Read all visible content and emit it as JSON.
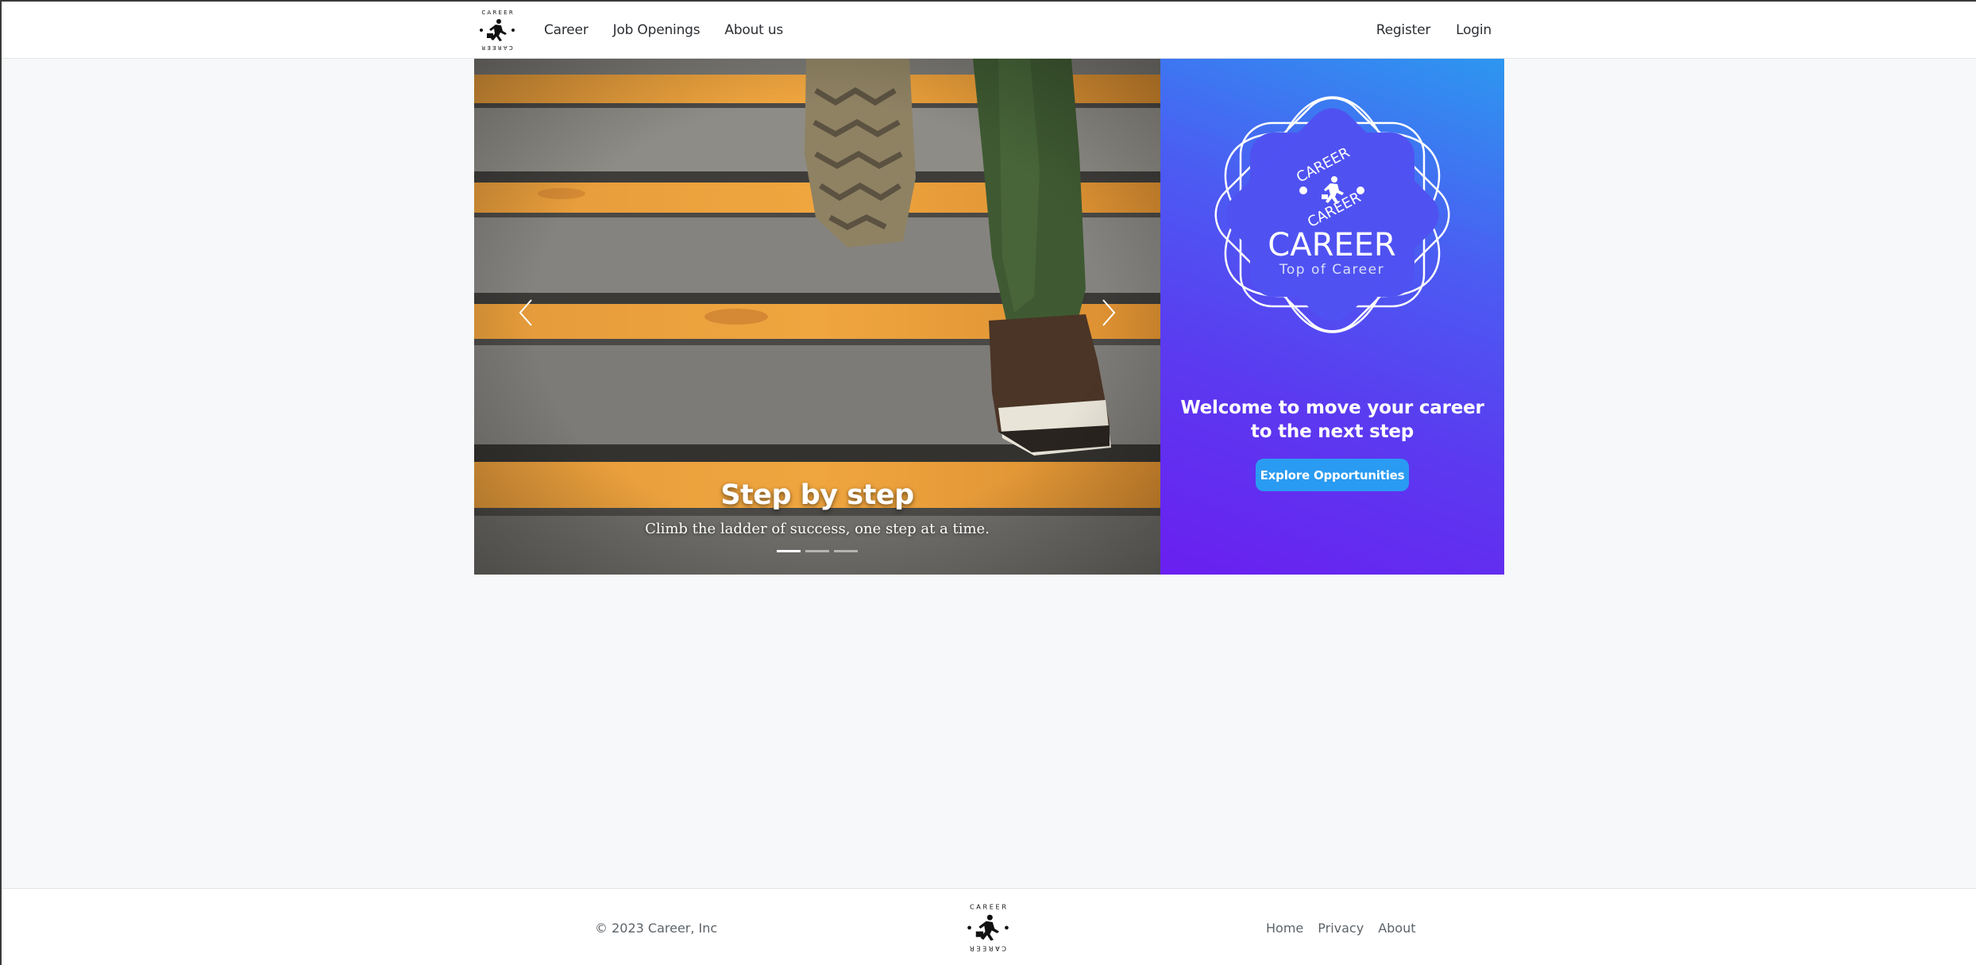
{
  "navbar": {
    "brand_logo": "career-runner-logo",
    "links": [
      {
        "label": "Career"
      },
      {
        "label": "Job Openings"
      },
      {
        "label": "About us"
      }
    ],
    "auth": {
      "register_label": "Register",
      "login_label": "Login"
    }
  },
  "carousel": {
    "slide_title": "Step by step",
    "slide_text": "Climb the ladder of success, one step at a time.",
    "prev_icon": "chevron-left-icon",
    "next_icon": "chevron-right-icon",
    "slide_count": 3,
    "active_slide": 1
  },
  "promo": {
    "logo_title": "CAREER",
    "logo_subtitle": "Top of Career",
    "logo_ring_text": "CAREER",
    "heading": "Welcome to move your career to the next step",
    "button_label": "Explore Opportunities",
    "gradient_colors": [
      "#2d97f0",
      "#5b3af0",
      "#6a1ff0"
    ],
    "button_color": "#2a9bf2"
  },
  "footer": {
    "copyright": "© 2023 Career, Inc",
    "links": [
      {
        "label": "Home"
      },
      {
        "label": "Privacy"
      },
      {
        "label": "About"
      }
    ]
  }
}
